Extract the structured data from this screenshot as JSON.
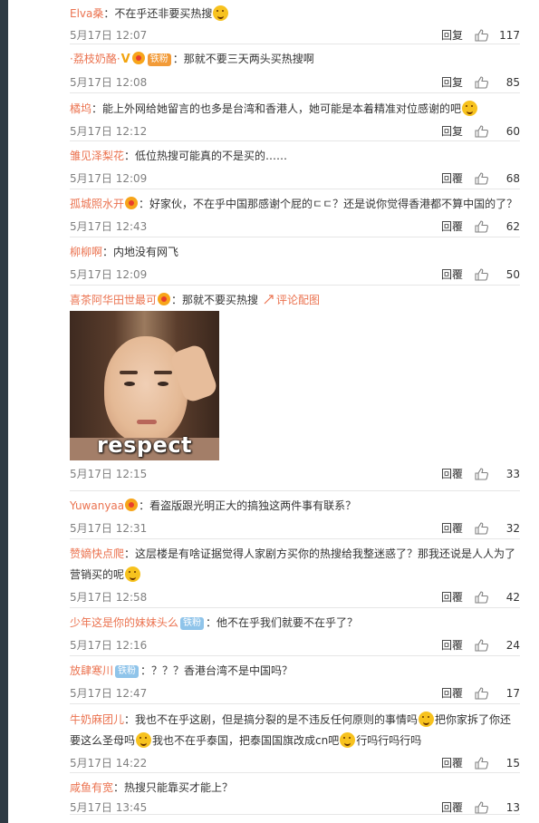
{
  "labels": {
    "reply": "回复",
    "reply_alt": "回覆",
    "colon": "：",
    "view_pic": "评论配图"
  },
  "colors": {
    "username": "#eb7350",
    "time": "#808080",
    "divider": "#e6e6e6",
    "badge": "#8fc4ea"
  },
  "photo_caption": "respect",
  "comments": [
    {
      "user": "Elva桑",
      "text": "不在乎还非要买热搜",
      "time": "5月17日 12:07",
      "reply": "回复",
      "likes": "117"
    },
    {
      "user": "·荔枝奶酪·",
      "badge": "铁粉",
      "text": "那就不要三天两头买热搜啊",
      "time": "5月17日 12:08",
      "reply": "回复",
      "likes": "85"
    },
    {
      "user": "橘坞",
      "text": "能上外网给她留言的也多是台湾和香港人，她可能是本着精准对位感谢的吧",
      "time": "5月17日 12:12",
      "reply": "回复",
      "likes": "60"
    },
    {
      "user": "雏见泽梨花",
      "text": "低位热搜可能真的不是买的……",
      "time": "5月17日 12:09",
      "reply": "回覆",
      "likes": "68"
    },
    {
      "user": "孤城照水开",
      "text": "好家伙，不在乎中国那感谢个屁的ㄷㄷ？还是说你觉得香港都不算中国的了？",
      "time": "5月17日 12:43",
      "reply": "回覆",
      "likes": "62"
    },
    {
      "user": "柳柳啊",
      "text": "内地没有网飞",
      "time": "5月17日 12:09",
      "reply": "回覆",
      "likes": "50"
    },
    {
      "user": "喜茶阿华田世最可",
      "text": "那就不要买热搜",
      "time": "5月17日 12:15",
      "reply": "回覆",
      "likes": "33"
    },
    {
      "user": "Yuwanyaa",
      "text": "看盗版跟光明正大的搞独这两件事有联系？",
      "time": "5月17日 12:31",
      "reply": "回覆",
      "likes": "32"
    },
    {
      "user": "赞嫡快点爬",
      "text": "这层楼是有啥证据觉得人家剧方买你的热搜给我整迷惑了？那我还说是人人为了",
      "text2": "营销买的呢",
      "time": "5月17日 12:58",
      "reply": "回覆",
      "likes": "42"
    },
    {
      "user": "少年这是你的妹妹头么",
      "badge": "铁粉",
      "text": "他不在乎我们就要不在乎了？",
      "time": "5月17日 12:16",
      "reply": "回覆",
      "likes": "24"
    },
    {
      "user": "放肆寒川",
      "badge": "铁粉",
      "text": "？？？香港台湾不是中国吗？",
      "time": "5月17日 12:47",
      "reply": "回覆",
      "likes": "17"
    },
    {
      "user": "牛奶麻团儿",
      "text": "我也不在乎这剧，但是搞分裂的是不违反任何原则的事情吗",
      "text_b": "把你家拆了你还",
      "text2": "要这么圣母吗",
      "text2_b": "我也不在乎泰国，把泰国国旗改成cn吧",
      "text2_c": "行吗行吗行吗",
      "time": "5月17日 14:22",
      "reply": "回覆",
      "likes": "15"
    },
    {
      "user": "咸鱼有宽",
      "text": "热搜只能靠买才能上？",
      "time": "5月17日 13:45",
      "reply": "回覆",
      "likes": "13"
    }
  ]
}
